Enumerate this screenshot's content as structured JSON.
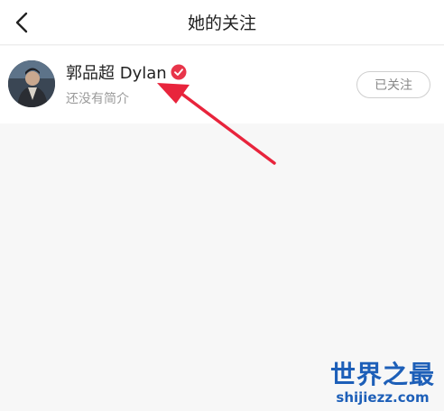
{
  "header": {
    "title": "她的关注",
    "back_icon": "chevron-left-icon"
  },
  "following": [
    {
      "name": "郭品超 Dylan",
      "verified": true,
      "verified_icon": "verified-check-icon",
      "bio": "还没有简介",
      "follow_label": "已关注"
    }
  ],
  "colors": {
    "verified_badge": "#e8354a",
    "arrow": "#e8243c",
    "watermark": "#1d5fb8"
  },
  "watermark": {
    "title": "世界之最",
    "url": "shijiezz.com"
  }
}
